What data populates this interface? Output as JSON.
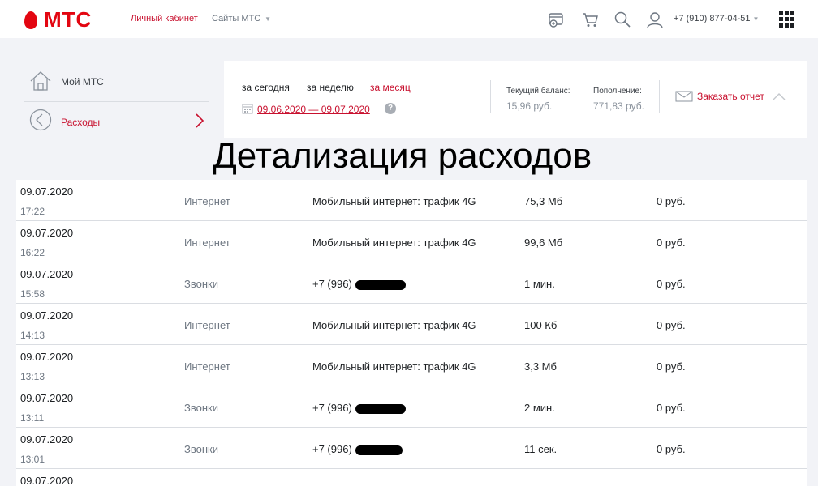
{
  "header": {
    "logo_text": "МТС",
    "nav_cabinet": "Личный кабинет",
    "nav_sites": "Сайты МТС",
    "phone": "+7 (910) 877-04-51",
    "icons": [
      "wallet-plus-icon",
      "cart-icon",
      "search-icon",
      "user-icon",
      "apps-grid-icon"
    ],
    "brand_color": "#e30611"
  },
  "sidebar": {
    "items": [
      {
        "label": "Мой МТС",
        "icon": "home-icon"
      },
      {
        "label": "Расходы",
        "icon": "back-circle-icon"
      }
    ]
  },
  "filters": {
    "periods": [
      "за сегодня",
      "за неделю",
      "за месяц"
    ],
    "active_period": "за месяц",
    "date_range": "09.06.2020 — 09.07.2020",
    "help": "?"
  },
  "balance": {
    "label": "Текущий баланс:",
    "value": "15,96 руб."
  },
  "topup": {
    "label": "Пополнение:",
    "value": "771,83 руб."
  },
  "report": {
    "label": "Заказать отчет"
  },
  "title": "Детализация расходов",
  "rows": [
    {
      "date": "09.07.2020",
      "time": "17:22",
      "type": "Интернет",
      "desc": "Мобильный интернет: трафик 4G",
      "amount": "75,3 Мб",
      "cost": "0 руб."
    },
    {
      "date": "09.07.2020",
      "time": "16:22",
      "type": "Интернет",
      "desc": "Мобильный интернет: трафик 4G",
      "amount": "99,6 Мб",
      "cost": "0 руб."
    },
    {
      "date": "09.07.2020",
      "time": "15:58",
      "type": "Звонки",
      "desc": "+7 (996)",
      "amount": "1 мин.",
      "cost": "0 руб."
    },
    {
      "date": "09.07.2020",
      "time": "14:13",
      "type": "Интернет",
      "desc": "Мобильный интернет: трафик 4G",
      "amount": "100 Кб",
      "cost": "0 руб."
    },
    {
      "date": "09.07.2020",
      "time": "13:13",
      "type": "Интернет",
      "desc": "Мобильный интернет: трафик 4G",
      "amount": "3,3 Мб",
      "cost": "0 руб."
    },
    {
      "date": "09.07.2020",
      "time": "13:11",
      "type": "Звонки",
      "desc": "+7 (996)",
      "amount": "2 мин.",
      "cost": "0 руб."
    },
    {
      "date": "09.07.2020",
      "time": "13:01",
      "type": "Звонки",
      "desc": "+7 (996)",
      "amount": "11 сек.",
      "cost": "0 руб."
    },
    {
      "date": "09.07.2020",
      "time": "",
      "type": "",
      "desc": "",
      "amount": "",
      "cost": ""
    }
  ]
}
